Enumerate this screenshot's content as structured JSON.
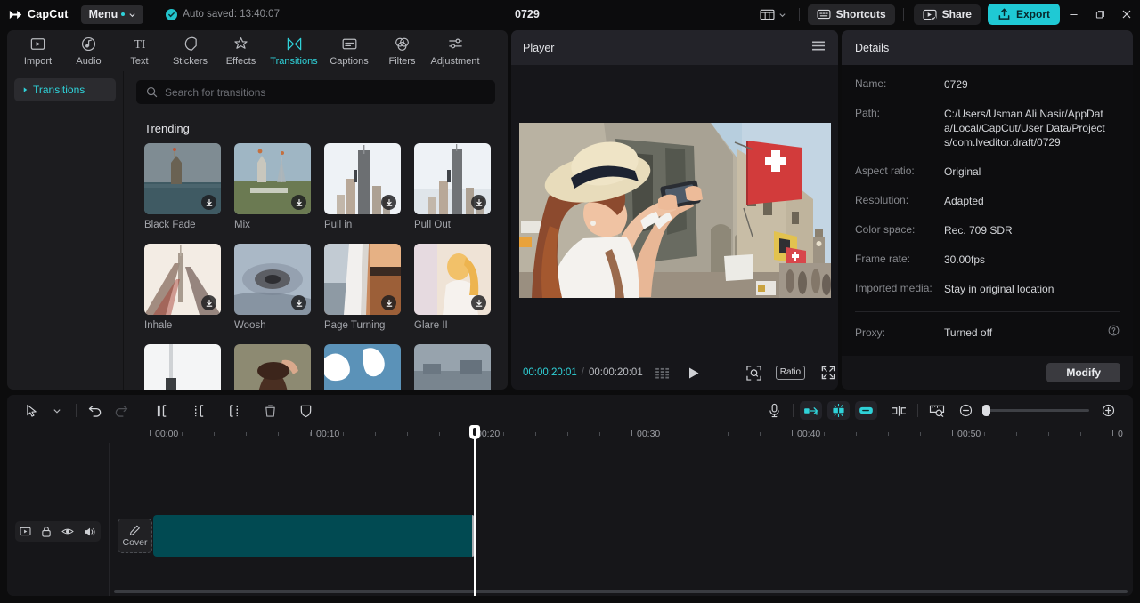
{
  "titlebar": {
    "app_name": "CapCut",
    "menu_label": "Menu",
    "autosave_text": "Auto saved: 13:40:07",
    "project_title": "0729",
    "layout_icon": "layout-icon",
    "layout_caret_icon": "chevron-down-icon",
    "shortcuts_label": "Shortcuts",
    "shortcuts_icon": "keyboard-icon",
    "share_label": "Share",
    "share_icon": "share-screen-icon",
    "export_label": "Export",
    "export_icon": "upload-icon",
    "minimize_icon": "minimize-icon",
    "maximize_icon": "maximize-icon",
    "close_icon": "close-icon",
    "accent_color": "#1fc9d4"
  },
  "library": {
    "categories": [
      {
        "label": "Import",
        "icon": "import-icon",
        "active": false
      },
      {
        "label": "Audio",
        "icon": "audio-icon",
        "active": false
      },
      {
        "label": "Text",
        "icon": "text-icon",
        "active": false
      },
      {
        "label": "Stickers",
        "icon": "stickers-icon",
        "active": false
      },
      {
        "label": "Effects",
        "icon": "effects-icon",
        "active": false
      },
      {
        "label": "Transitions",
        "icon": "transitions-icon",
        "active": true
      },
      {
        "label": "Captions",
        "icon": "captions-icon",
        "active": false
      },
      {
        "label": "Filters",
        "icon": "filters-icon",
        "active": false
      },
      {
        "label": "Adjustment",
        "icon": "adjustment-icon",
        "active": false
      }
    ],
    "sidebar": {
      "items": [
        {
          "label": "Transitions",
          "icon": "caret-right-icon"
        }
      ]
    },
    "search": {
      "placeholder": "Search for transitions",
      "value": "",
      "icon": "search-icon"
    },
    "section_title": "Trending",
    "items": [
      {
        "label": "Black Fade",
        "download_icon": "download-icon"
      },
      {
        "label": "Mix",
        "download_icon": "download-icon"
      },
      {
        "label": "Pull in",
        "download_icon": "download-icon"
      },
      {
        "label": "Pull Out",
        "download_icon": "download-icon"
      },
      {
        "label": "Inhale",
        "download_icon": "download-icon"
      },
      {
        "label": "Woosh",
        "download_icon": "download-icon"
      },
      {
        "label": "Page Turning",
        "download_icon": "download-icon"
      },
      {
        "label": "Glare II",
        "download_icon": "download-icon"
      },
      {
        "label": "",
        "download_icon": "download-icon"
      },
      {
        "label": "",
        "download_icon": "download-icon"
      },
      {
        "label": "",
        "download_icon": "download-icon"
      },
      {
        "label": "",
        "download_icon": "download-icon"
      }
    ]
  },
  "player": {
    "title": "Player",
    "menu_icon": "hamburger-icon",
    "current_time": "00:00:20:01",
    "time_separator": "/",
    "total_time": "00:00:20:01",
    "frames_icon": "frames-icon",
    "play_icon": "play-icon",
    "zoom_fit_icon": "zoom-fit-icon",
    "ratio_label": "Ratio",
    "fullscreen_icon": "fullscreen-icon"
  },
  "details": {
    "title": "Details",
    "rows": [
      {
        "label": "Name:",
        "value": "0729"
      },
      {
        "label": "Path:",
        "value": "C:/Users/Usman Ali Nasir/AppData/Local/CapCut/User Data/Projects/com.lveditor.draft/0729"
      },
      {
        "label": "Aspect ratio:",
        "value": "Original"
      },
      {
        "label": "Resolution:",
        "value": "Adapted"
      },
      {
        "label": "Color space:",
        "value": "Rec. 709 SDR"
      },
      {
        "label": "Frame rate:",
        "value": "30.00fps"
      },
      {
        "label": "Imported media:",
        "value": "Stay in original location"
      }
    ],
    "proxy": {
      "label": "Proxy:",
      "value": "Turned off",
      "help_icon": "question-icon"
    },
    "modify_label": "Modify"
  },
  "timeline": {
    "tools_left": [
      {
        "icon": "cursor-icon",
        "name": "select-tool"
      },
      {
        "icon": "chevron-down-icon",
        "name": "select-tool-dropdown"
      },
      {
        "icon": "undo-icon",
        "name": "undo-button"
      },
      {
        "icon": "redo-icon",
        "name": "redo-button"
      },
      {
        "icon": "split-left-icon",
        "name": "trim-left-button"
      },
      {
        "icon": "split-icon",
        "name": "split-button"
      },
      {
        "icon": "split-right-icon",
        "name": "trim-right-button"
      },
      {
        "icon": "delete-icon",
        "name": "delete-button"
      },
      {
        "icon": "shield-icon",
        "name": "freeze-button"
      }
    ],
    "tools_right": [
      {
        "icon": "microphone-icon",
        "name": "record-voiceover-button"
      },
      {
        "icon": "mirror-icon",
        "name": "mirror-button"
      },
      {
        "icon": "auto-cut-icon",
        "name": "auto-cut-button"
      },
      {
        "icon": "speed-icon",
        "name": "speed-button"
      },
      {
        "icon": "split-clip-icon",
        "name": "split-clip-button"
      },
      {
        "icon": "preview-icon",
        "name": "preview-button"
      },
      {
        "icon": "zoom-out-icon",
        "name": "zoom-out-button"
      },
      {
        "icon": "zoom-in-icon",
        "name": "zoom-in-button"
      }
    ],
    "ruler_labels": [
      "00:00",
      "00:10",
      "00:20",
      "00:30",
      "00:40",
      "00:50",
      "0"
    ],
    "track_controls": [
      {
        "icon": "track-icon",
        "name": "track-thumbnail-toggle"
      },
      {
        "icon": "lock-icon",
        "name": "track-lock-toggle"
      },
      {
        "icon": "eye-icon",
        "name": "track-visibility-toggle"
      },
      {
        "icon": "volume-icon",
        "name": "track-mute-toggle"
      }
    ],
    "cover_label": "Cover",
    "cover_icon": "pencil-icon",
    "clip_color": "#014a52",
    "playhead_position": "00:20"
  }
}
